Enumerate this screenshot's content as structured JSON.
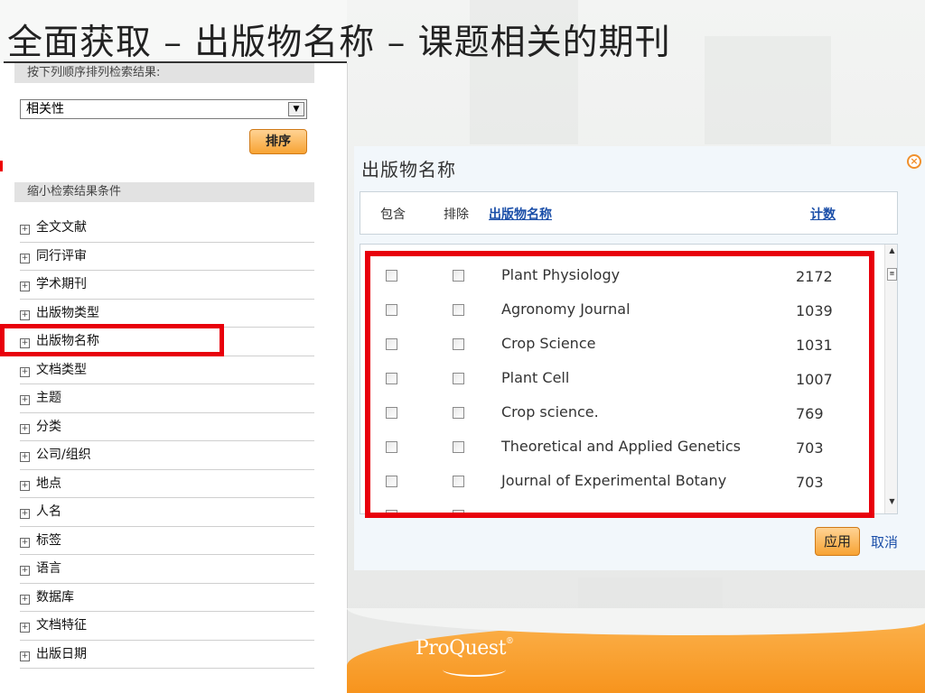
{
  "slide": {
    "title": "全面获取 – 出版物名称 – 课题相关的期刊"
  },
  "sort": {
    "heading": "按下列顺序排列检索结果:",
    "selected": "相关性",
    "button": "排序"
  },
  "narrow": {
    "heading": "缩小检索结果条件",
    "facets": [
      "全文文献",
      "同行评审",
      "学术期刊",
      "出版物类型",
      "出版物名称",
      "文档类型",
      "主题",
      "分类",
      "公司/组织",
      "地点",
      "人名",
      "标签",
      "语言",
      "数据库",
      "文档特征",
      "出版日期"
    ]
  },
  "dialog": {
    "title": "出版物名称",
    "col_include": "包含",
    "col_exclude": "排除",
    "col_name": "出版物名称",
    "col_count": "计数",
    "rows": [
      {
        "name": "Plant Physiology",
        "count": "2172"
      },
      {
        "name": "Agronomy Journal",
        "count": "1039"
      },
      {
        "name": "Crop Science",
        "count": "1031"
      },
      {
        "name": "Plant Cell",
        "count": "1007"
      },
      {
        "name": "Crop science.",
        "count": "769"
      },
      {
        "name": "Theoretical and Applied Genetics",
        "count": "703"
      },
      {
        "name": "Journal of Experimental Botany",
        "count": "703"
      }
    ],
    "apply": "应用",
    "cancel": "取消"
  },
  "brand": {
    "logo": "ProQuest",
    "logo_mark": "®"
  },
  "colors": {
    "highlight": "#e8000b",
    "accent": "#f7a333",
    "link": "#1a4ea8"
  }
}
